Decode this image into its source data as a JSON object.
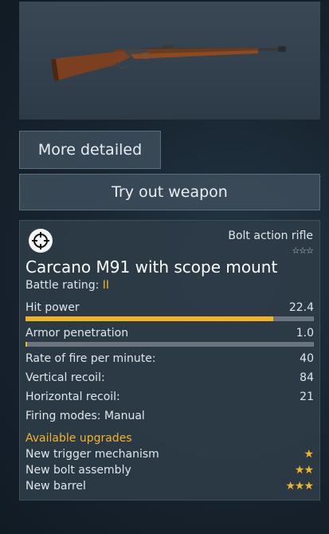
{
  "buttons": {
    "more_detailed": "More detailed",
    "try_out": "Try out weapon"
  },
  "weapon": {
    "type": "Bolt action rifle",
    "rank_stars": "☆☆☆",
    "name": "Carcano M91 with scope mount",
    "battle_rating_label": "Battle rating:",
    "battle_rating_value": "II",
    "hit_power": {
      "label": "Hit power",
      "value": "22.4",
      "bar_fraction": 0.86
    },
    "armor_penetration": {
      "label": "Armor penetration",
      "value": "1.0",
      "bar_fraction": 0.005
    },
    "rate_of_fire": {
      "label": "Rate of fire per minute:",
      "value": "40"
    },
    "vertical_recoil": {
      "label": "Vertical recoil:",
      "value": "84"
    },
    "horizontal_recoil": {
      "label": "Horizontal recoil:",
      "value": "21"
    },
    "firing_modes": "Firing modes: Manual"
  },
  "upgrades": {
    "heading": "Available upgrades",
    "items": [
      {
        "label": "New trigger mechanism",
        "stars": "★"
      },
      {
        "label": "New bolt assembly",
        "stars": "★★"
      },
      {
        "label": "New barrel",
        "stars": "★★★"
      }
    ]
  },
  "icons": {
    "weapon_class": "crosshair-icon",
    "weapon_image": "rifle-icon"
  },
  "colors": {
    "accent": "#f0b429",
    "bar_track": "#6c757d"
  }
}
